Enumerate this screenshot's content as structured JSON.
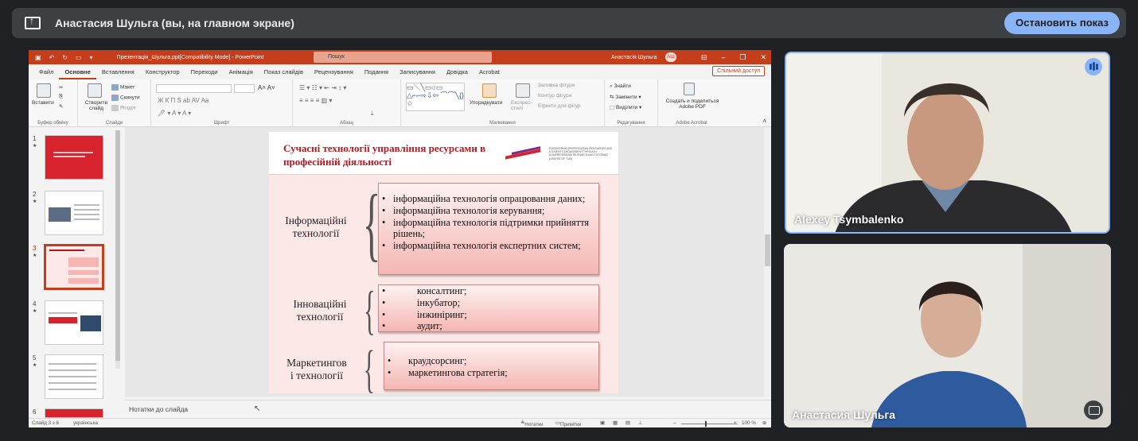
{
  "banner": {
    "title": "Анастасия Шульга (вы, на главном экране)",
    "stop_label": "Остановить показ"
  },
  "ppt": {
    "doc_title": "Презентація_Шульга.ppt[Compatibility Mode]  -  PowerPoint",
    "search_placeholder": "Пошук",
    "user_name": "Анастасія Шульга",
    "user_initials": "АШ",
    "menu": [
      "Файл",
      "Основне",
      "Вставлення",
      "Конструктор",
      "Переходи",
      "Анімація",
      "Показ слайдів",
      "Рецензування",
      "Подання",
      "Записування",
      "Довідка",
      "Acrobat"
    ],
    "shared_label": "Спільний доступ",
    "ribbon": {
      "paste": "Вставити",
      "clipboard": "Буфер обміну",
      "new_slide": "Створити слайд",
      "layout": "Макет",
      "reset": "Скинути",
      "section": "Розділ",
      "slides": "Слайди",
      "font": "Шрифт",
      "paragraph": "Абзац",
      "arrange": "Упорядкувати",
      "quick_styles": "Експрес-стилі",
      "shape_fill": "Заливка фігури",
      "shape_outline": "Контур фігури",
      "shape_effects": "Ефекти для фігур",
      "drawing": "Малювання",
      "find": "Знайти",
      "replace": "Замінити",
      "select": "Виділити",
      "editing": "Редагування",
      "create_pdf": "Создать и поделиться Adobe PDF",
      "adobe": "Adobe Acrobat"
    },
    "thumbs": [
      {
        "num": "1",
        "star": "★"
      },
      {
        "num": "2",
        "star": "★"
      },
      {
        "num": "3",
        "star": "★"
      },
      {
        "num": "4",
        "star": "★"
      },
      {
        "num": "5",
        "star": "★"
      },
      {
        "num": "6",
        "star": ""
      }
    ],
    "slide": {
      "title": "Сучасні технології управління ресурсами в професійній діяльності",
      "logo_text": "ENGINEERING PROFESSIONAL RESOURCES AND STUDENTS ENGAGEMENT THROUGH COMPREHENSIVE RESEARCH AND TUTORING (CENTRE OF TUM)",
      "cat1": [
        "Інформаційні",
        "технології"
      ],
      "items1": [
        "інформаційна технологія опрацювання даних;",
        "інформаційна технологія керування;",
        "інформаційна технологія підтримки прийняття рішень;",
        "інформаційна технологія експертних систем;"
      ],
      "cat2": [
        "Інноваційні",
        "технології"
      ],
      "items2": [
        "консалтинг;",
        "інкубатор;",
        "інжиніринг;",
        "аудит;"
      ],
      "cat3": [
        "Маркетингов",
        "і технології"
      ],
      "items3": [
        "краудсорсинг;",
        "маркетингова стратегія;"
      ]
    },
    "notes_label": "Нотатки до слайда",
    "status": {
      "slide": "Слайд 3 з 6",
      "lang": "українська",
      "notes": "Нотатки",
      "comments": "Примітки",
      "zoom": "100 %"
    }
  },
  "tiles": [
    {
      "name": "Alexey Tsymbalenko"
    },
    {
      "name": "Анастасия Шульга"
    }
  ]
}
